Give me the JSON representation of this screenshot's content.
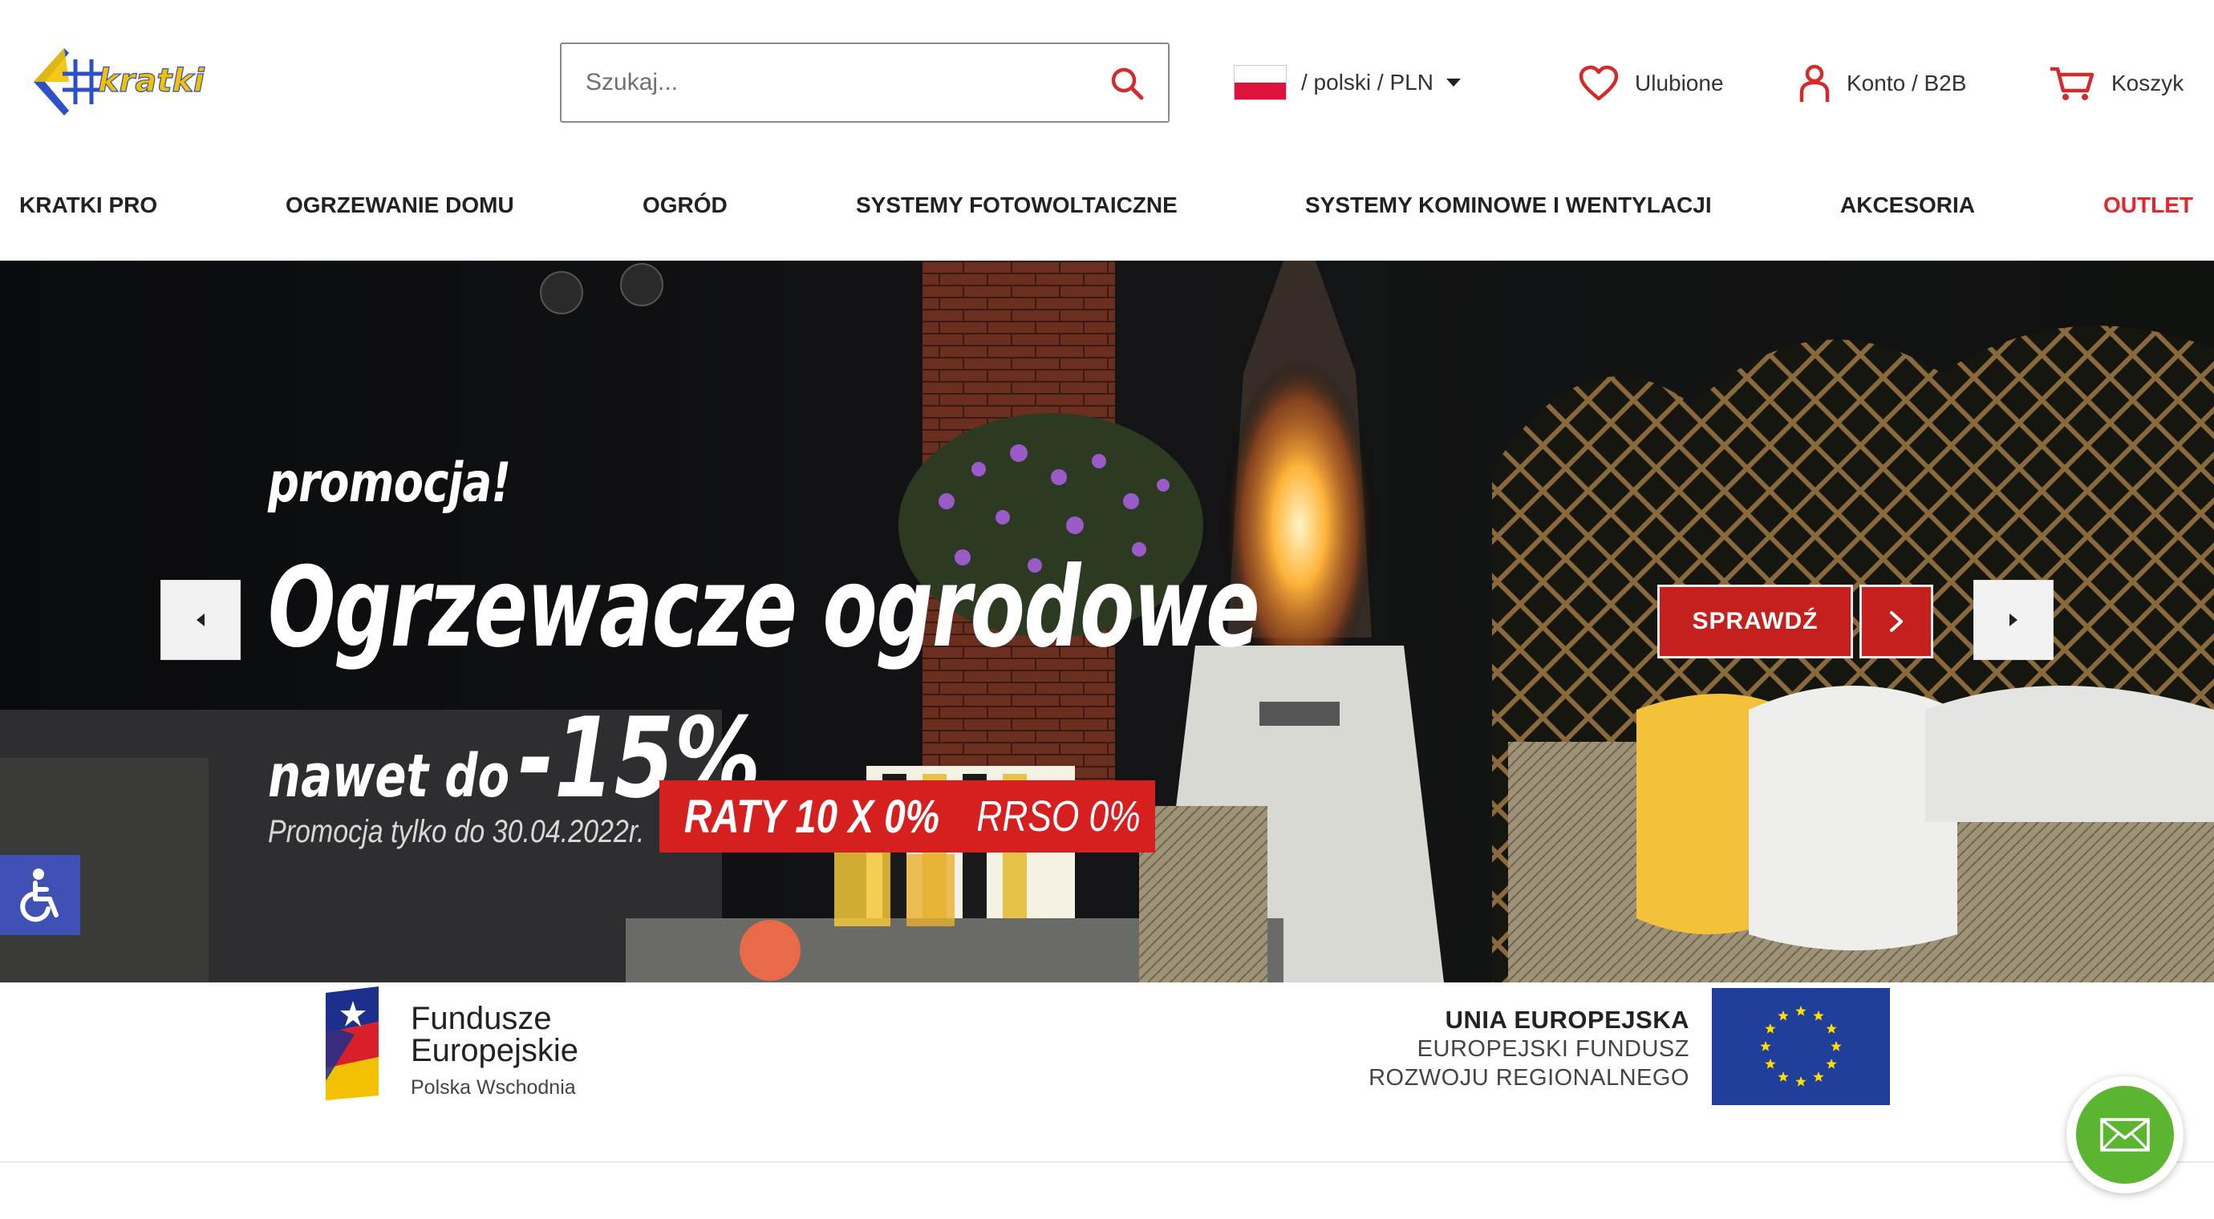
{
  "header": {
    "search_placeholder": "Szukaj...",
    "language_currency": "/ polski / PLN",
    "favorites_label": "Ulubione",
    "account_label": "Konto / B2B",
    "cart_label": "Koszyk"
  },
  "nav": {
    "items": [
      "KRATKI PRO",
      "OGRZEWANIE DOMU",
      "OGRÓD",
      "SYSTEMY FOTOWOLTAICZNE",
      "SYSTEMY KOMINOWE I WENTYLACJI",
      "AKCESORIA",
      "OUTLET"
    ]
  },
  "hero": {
    "promo_small": "promocja!",
    "title": "Ogrzewacze ogrodowe",
    "upto_prefix": "nawet do",
    "discount": "-15%",
    "date_note": "Promocja tylko do 30.04.2022r.",
    "raty_bold": "RATY 10 X 0%",
    "raty_light": "RRSO 0%",
    "cta_label": "SPRAWDŹ"
  },
  "eu": {
    "fe_line1": "Fundusze",
    "fe_line2": "Europejskie",
    "fe_line3": "Polska Wschodnia",
    "ue_line1": "UNIA EUROPEJSKA",
    "ue_line2": "EUROPEJSKI FUNDUSZ",
    "ue_line3": "ROZWOJU REGIONALNEGO"
  },
  "colors": {
    "accent_red": "#e3272b",
    "cta_red": "#c4201e",
    "accessibility_blue": "#3f51b5",
    "chat_green": "#5cb531",
    "eu_blue": "#1f3f9a",
    "eu_star": "#ffdd00"
  },
  "icons": [
    "search-icon",
    "heart-icon",
    "user-icon",
    "cart-icon",
    "chevron-left-icon",
    "chevron-right-icon",
    "accessibility-icon",
    "envelope-icon"
  ]
}
